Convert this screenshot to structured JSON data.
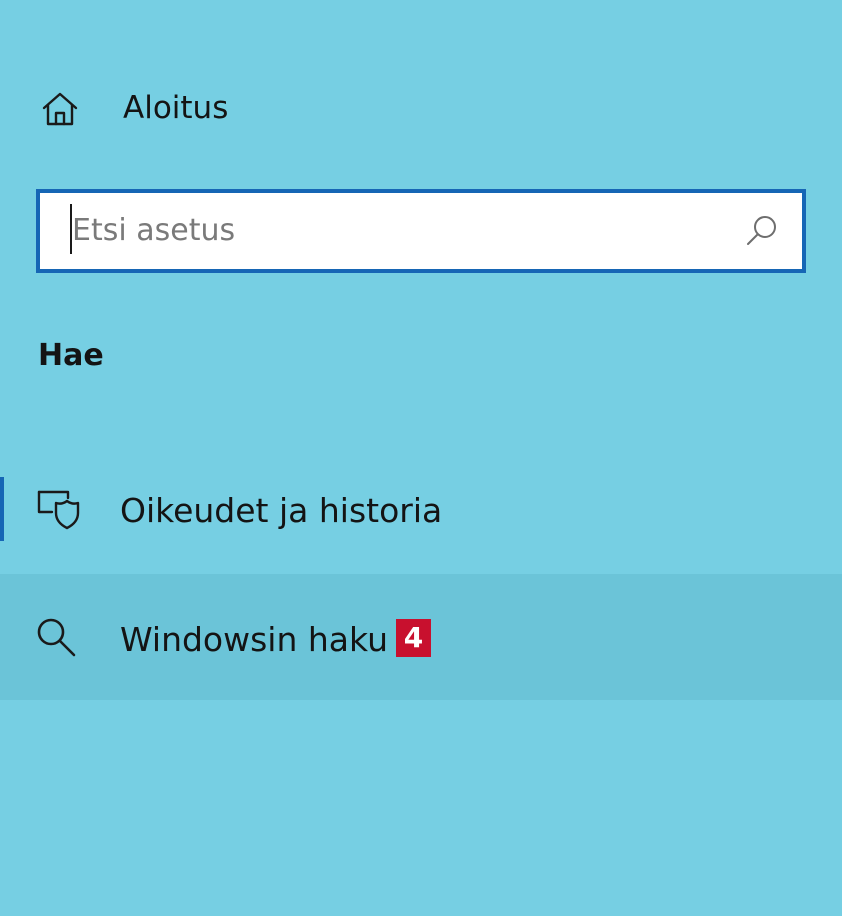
{
  "nav": {
    "home_label": "Aloitus",
    "home_icon": "home-icon"
  },
  "search": {
    "placeholder": "Etsi asetus",
    "value": "",
    "icon": "search-icon"
  },
  "section": {
    "heading": "Hae"
  },
  "items": [
    {
      "label": "Oikeudet ja historia",
      "icon": "permissions-history-icon",
      "selected": true
    },
    {
      "label": "Windowsin haku",
      "icon": "magnifier-icon",
      "hovered": true
    }
  ],
  "callout": {
    "number": "4",
    "color": "#c8102e"
  },
  "colors": {
    "background": "#76cfe3",
    "accent": "#1666b5",
    "hover_row": "#6bc4d8"
  }
}
